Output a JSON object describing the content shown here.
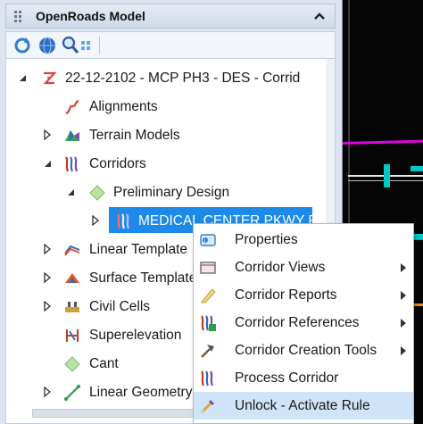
{
  "panel": {
    "title": "OpenRoads Model"
  },
  "toolbar": {
    "buttons": [
      {
        "icon": "refresh-icon"
      },
      {
        "icon": "globe-icon"
      },
      {
        "icon": "zoom-icon"
      },
      {
        "icon": "grid-icon"
      }
    ]
  },
  "tree": {
    "items": [
      {
        "label": "22-12-2102 - MCP PH3 - DES - Corrid",
        "icon": "model-icon",
        "expanded": true
      },
      {
        "label": "Alignments",
        "icon": "alignment-icon"
      },
      {
        "label": "Terrain Models",
        "icon": "terrain-icon",
        "expanded": false
      },
      {
        "label": "Corridors",
        "icon": "corridors-icon",
        "expanded": true
      },
      {
        "label": "Preliminary Design",
        "icon": "design-stage-icon",
        "expanded": true
      },
      {
        "label": "MEDICAL CENTER PKWY P",
        "icon": "corridor-icon",
        "expanded": false,
        "selected": true
      },
      {
        "label": "Linear Template",
        "icon": "linear-template-icon",
        "expanded": false
      },
      {
        "label": "Surface Template",
        "icon": "surface-template-icon",
        "expanded": false
      },
      {
        "label": "Civil Cells",
        "icon": "civil-cells-icon",
        "expanded": false
      },
      {
        "label": "Superelevation",
        "icon": "superelevation-icon"
      },
      {
        "label": "Cant",
        "icon": "cant-icon"
      },
      {
        "label": "Linear Geometry",
        "icon": "linear-geometry-icon",
        "expanded": false
      }
    ]
  },
  "context_menu": {
    "items": [
      {
        "label": "Properties",
        "icon": "properties-icon",
        "submenu": false
      },
      {
        "label": "Corridor Views",
        "icon": "views-icon",
        "submenu": true
      },
      {
        "label": "Corridor Reports",
        "icon": "reports-icon",
        "submenu": true
      },
      {
        "label": "Corridor References",
        "icon": "references-icon",
        "submenu": true
      },
      {
        "label": "Corridor Creation Tools",
        "icon": "creation-tools-icon",
        "submenu": true
      },
      {
        "label": "Process Corridor",
        "icon": "process-corridor-icon",
        "submenu": false
      },
      {
        "label": "Unlock - Activate Rule",
        "icon": "unlock-icon",
        "submenu": false,
        "highlighted": true
      }
    ]
  },
  "colors": {
    "selection": "#1c8ae6",
    "menu_hover": "#cfe4f8",
    "viewport_bg": "#050505",
    "magenta_line": "#e000e0",
    "cyan_mark": "#00c8c8"
  }
}
